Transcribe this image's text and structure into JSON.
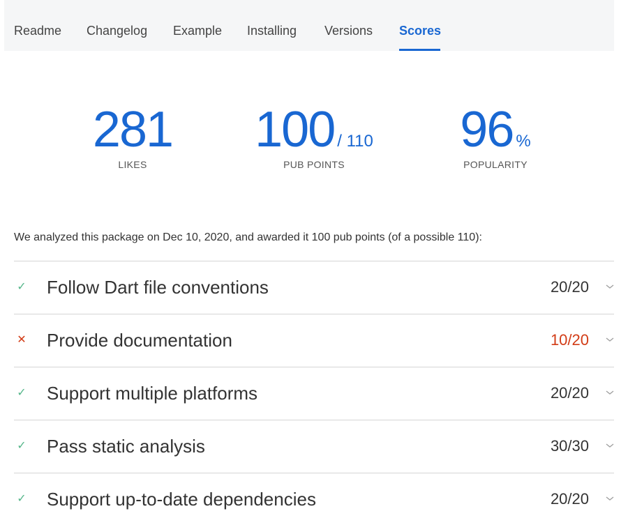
{
  "tabs": [
    {
      "label": "Readme",
      "active": false
    },
    {
      "label": "Changelog",
      "active": false
    },
    {
      "label": "Example",
      "active": false
    },
    {
      "label": "Installing",
      "active": false
    },
    {
      "label": "Versions",
      "active": false
    },
    {
      "label": "Scores",
      "active": true
    }
  ],
  "stats": {
    "likes": {
      "value": "281",
      "label": "LIKES"
    },
    "pub_points": {
      "value": "100",
      "suffix": "/ 110",
      "label": "PUB POINTS"
    },
    "popularity": {
      "value": "96",
      "suffix": "%",
      "label": "POPULARITY"
    }
  },
  "intro": "We analyzed this package on Dec 10, 2020, and awarded it 100 pub points (of a possible 110):",
  "sections": [
    {
      "title": "Follow Dart file conventions",
      "score": "20/20",
      "status": "pass",
      "status_icon": "check-icon"
    },
    {
      "title": "Provide documentation",
      "score": "10/20",
      "status": "fail",
      "status_icon": "cross-icon"
    },
    {
      "title": "Support multiple platforms",
      "score": "20/20",
      "status": "pass",
      "status_icon": "check-icon"
    },
    {
      "title": "Pass static analysis",
      "score": "30/30",
      "status": "pass",
      "status_icon": "check-icon"
    },
    {
      "title": "Support up-to-date dependencies",
      "score": "20/20",
      "status": "pass",
      "status_icon": "check-icon"
    }
  ],
  "colors": {
    "accent": "#1967d2",
    "pass": "#55b68a",
    "fail": "#d23c16",
    "tab_background": "#f5f6f7"
  }
}
